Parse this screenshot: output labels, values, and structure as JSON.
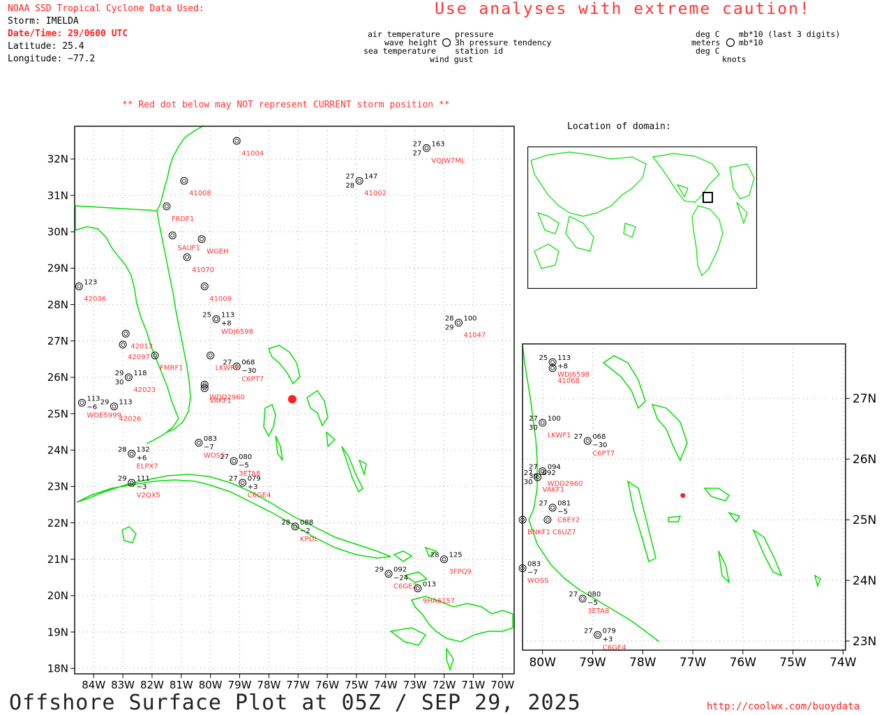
{
  "header": {
    "agency": "NOAA SSD Tropical Cyclone Data Used:",
    "storm": "Storm: IMELDA",
    "datetime": "Date/Time: 29/0600 UTC",
    "latitude": "Latitude: 25.4",
    "longitude": "Longitude: −77.2"
  },
  "caution": "Use analyses with extreme caution!",
  "legend_left": {
    "air_temp": "air temperature",
    "wave_height": "wave height",
    "sea_temp": "sea temperature",
    "pressure": "pressure",
    "tendency": "3h pressure tendency",
    "station_id": "station id",
    "wind_gust": "wind gust"
  },
  "legend_right": {
    "deg_c_top": "deg C",
    "meters": "meters",
    "deg_c_bottom": "deg C",
    "mb_top": "mb*10 (last 3 digits)",
    "mb_bottom": "mb*10",
    "knots": "knots"
  },
  "note": "** Red dot below may NOT represent CURRENT storm position **",
  "locator_title": "Location of domain:",
  "footer": {
    "title": "Offshore Surface Plot at 05Z / SEP 29, 2025",
    "url": "http://coolwx.com/buoydata"
  },
  "colors": {
    "coast": "#00dd00",
    "storm": "#ff2020",
    "station_red": "#ff3333",
    "station_blue": "#2244ff"
  },
  "main_map": {
    "lat_labels": [
      "32N",
      "31N",
      "30N",
      "29N",
      "28N",
      "27N",
      "26N",
      "25N",
      "24N",
      "23N",
      "22N",
      "21N",
      "20N",
      "19N",
      "18N"
    ],
    "lon_labels": [
      "84W",
      "83W",
      "82W",
      "81W",
      "80W",
      "79W",
      "78W",
      "77W",
      "76W",
      "75W",
      "74W",
      "73W",
      "72W",
      "71W",
      "70W"
    ],
    "storm_position": {
      "lat": 25.4,
      "lon": -77.2
    },
    "stations": [
      {
        "id": "41002",
        "lat": 31.4,
        "lon": -74.9,
        "temp": "27",
        "sst": "28",
        "pres": "147",
        "color": "red"
      },
      {
        "id": "VQJW7ML",
        "lat": 32.3,
        "lon": -72.6,
        "temp": "27",
        "sst": "27",
        "pres": "163",
        "color": "red"
      },
      {
        "id": "41047",
        "lat": 27.5,
        "lon": -71.5,
        "temp": "28",
        "sst": "29",
        "pres": "100",
        "color": "red"
      },
      {
        "id": "C6PT7",
        "lat": 26.3,
        "lon": -79.1,
        "temp": "27",
        "sst": "",
        "pres": "068",
        "tend": "−30",
        "color": "red"
      },
      {
        "id": "3ETA8",
        "lat": 23.7,
        "lon": -79.2,
        "temp": "27",
        "sst": "",
        "pres": "080",
        "tend": "−5",
        "color": "red"
      },
      {
        "id": "C6GE4",
        "lat": 23.1,
        "lon": -78.9,
        "temp": "27",
        "sst": "",
        "pres": "079",
        "tend": "+3",
        "color": "red"
      },
      {
        "id": "KPDL",
        "lat": 21.9,
        "lon": -77.1,
        "temp": "28",
        "sst": "",
        "pres": "088",
        "tend": "−2",
        "color": "red"
      },
      {
        "id": "3FPQ9",
        "lat": 21.0,
        "lon": -72.0,
        "temp": "28",
        "sst": "",
        "pres": "125",
        "color": "red"
      },
      {
        "id": "C6GE2",
        "lat": 20.6,
        "lon": -73.9,
        "temp": "29",
        "sst": "",
        "pres": "092",
        "tend": "−24",
        "color": "red"
      },
      {
        "id": "9HA6157",
        "lat": 20.2,
        "lon": -72.9,
        "temp": "",
        "sst": "",
        "pres": "013",
        "color": "red"
      },
      {
        "id": "ELPX7",
        "lat": 23.9,
        "lon": -82.7,
        "temp": "28",
        "sst": "",
        "pres": "132",
        "tend": "+6",
        "color": "red"
      },
      {
        "id": "V2QX5",
        "lat": 23.1,
        "lon": -82.7,
        "temp": "29",
        "sst": "",
        "pres": "111",
        "tend": "−3",
        "color": "red"
      },
      {
        "id": "WDE5999",
        "lat": 25.3,
        "lon": -84.4,
        "temp": "",
        "sst": "",
        "pres": "113",
        "tend": "−6",
        "color": "red"
      },
      {
        "id": "42026",
        "lat": 25.2,
        "lon": -83.3,
        "temp": "29",
        "sst": "",
        "pres": "113",
        "color": "red"
      },
      {
        "id": "42023",
        "lat": 26.0,
        "lon": -82.8,
        "temp": "29",
        "sst": "30",
        "pres": "118",
        "color": "red"
      },
      {
        "id": "42036",
        "lat": 28.5,
        "lon": -84.5,
        "temp": "",
        "sst": "",
        "pres": "123",
        "color": "red"
      },
      {
        "id": "WOSS",
        "lat": 24.2,
        "lon": -80.4,
        "temp": "",
        "sst": "",
        "pres": "083",
        "tend": "−7",
        "color": "red"
      },
      {
        "id": "WDJ6598",
        "lat": 27.6,
        "lon": -79.8,
        "temp": "25",
        "sst": "",
        "pres": "113",
        "tend": "+8",
        "color": "red"
      },
      {
        "id": "41009",
        "lat": 28.5,
        "lon": -80.2,
        "temp": "",
        "sst": "",
        "pres": "",
        "color": "red"
      },
      {
        "id": "41070",
        "lat": 29.3,
        "lon": -80.8,
        "temp": "",
        "sst": "",
        "pres": "",
        "color": "red"
      },
      {
        "id": "41004",
        "lat": 32.5,
        "lon": -79.1,
        "temp": "",
        "sst": "",
        "pres": "",
        "color": "red"
      },
      {
        "id": "41008",
        "lat": 31.4,
        "lon": -80.9,
        "temp": "",
        "sst": "",
        "pres": "",
        "color": "red"
      },
      {
        "id": "FRDF1",
        "lat": 30.7,
        "lon": -81.5,
        "temp": "",
        "sst": "",
        "pres": "",
        "color": "red"
      },
      {
        "id": "SAUF1",
        "lat": 29.9,
        "lon": -81.3,
        "temp": "",
        "sst": "",
        "pres": "",
        "color": "red"
      },
      {
        "id": "WGEH",
        "lat": 29.8,
        "lon": -80.3,
        "temp": "",
        "sst": "",
        "pres": "",
        "color": "red"
      },
      {
        "id": "FMRF1",
        "lat": 26.6,
        "lon": -81.9,
        "temp": "",
        "sst": "",
        "pres": "",
        "color": "red"
      },
      {
        "id": "42097",
        "lat": 26.9,
        "lon": -83.0,
        "temp": "",
        "sst": "",
        "pres": "",
        "color": "red"
      },
      {
        "id": "42013",
        "lat": 27.2,
        "lon": -82.9,
        "temp": "",
        "sst": "",
        "pres": "",
        "color": "red"
      },
      {
        "id": "VAKF1",
        "lat": 25.7,
        "lon": -80.2,
        "temp": "",
        "sst": "",
        "pres": "",
        "color": "red"
      },
      {
        "id": "WDD2960",
        "lat": 25.8,
        "lon": -80.2,
        "temp": "",
        "sst": "",
        "pres": "",
        "color": "red"
      },
      {
        "id": "LKWF1",
        "lat": 26.6,
        "lon": -80.0,
        "temp": "",
        "sst": "",
        "pres": "",
        "color": "red"
      }
    ]
  },
  "inset_map": {
    "lat_labels": [
      "27N",
      "26N",
      "25N",
      "24N",
      "23N"
    ],
    "lon_labels": [
      "80W",
      "79W",
      "78W",
      "77W",
      "76W",
      "75W",
      "74W"
    ],
    "storm_position": {
      "lat": 25.4,
      "lon": -77.2
    },
    "stations": [
      {
        "id": "WDJ6598",
        "lat": 27.6,
        "lon": -79.8,
        "temp": "25",
        "pres": "113",
        "tend": "+8",
        "color": "red"
      },
      {
        "id": "41068",
        "lat": 27.5,
        "lon": -79.8,
        "temp": "",
        "pres": "",
        "color": "red"
      },
      {
        "id": "C6PT7",
        "lat": 26.3,
        "lon": -79.1,
        "temp": "27",
        "pres": "068",
        "tend": "−30",
        "color": "red"
      },
      {
        "id": "LKWF1",
        "lat": 26.6,
        "lon": -80.0,
        "temp": "27",
        "sst": "30",
        "pres": "100",
        "color": "red"
      },
      {
        "id": "WDD2960",
        "lat": 25.8,
        "lon": -80.0,
        "temp": "27",
        "sst": "30",
        "pres": "094",
        "color": "red"
      },
      {
        "id": "VAKF1",
        "lat": 25.7,
        "lon": -80.1,
        "temp": "27",
        "sst": "30",
        "pres": "092",
        "color": "red"
      },
      {
        "id": "C6EY2",
        "lat": 25.2,
        "lon": -79.8,
        "temp": "27",
        "pres": "081",
        "tend": "−5",
        "color": "red"
      },
      {
        "id": "C6UZ7",
        "lat": 25.0,
        "lon": -79.9,
        "temp": "",
        "pres": "",
        "color": "red"
      },
      {
        "id": "BNKF1",
        "lat": 25.0,
        "lon": -80.4,
        "temp": "",
        "pres": "",
        "color": "red"
      },
      {
        "id": "WOSS",
        "lat": 24.2,
        "lon": -80.4,
        "temp": "",
        "pres": "083",
        "tend": "−7",
        "color": "red"
      },
      {
        "id": "3ETA8",
        "lat": 23.7,
        "lon": -79.2,
        "temp": "27",
        "pres": "080",
        "tend": "−5",
        "color": "red"
      },
      {
        "id": "C6GE4",
        "lat": 23.1,
        "lon": -78.9,
        "temp": "27",
        "pres": "079",
        "tend": "+3",
        "color": "red"
      }
    ]
  }
}
